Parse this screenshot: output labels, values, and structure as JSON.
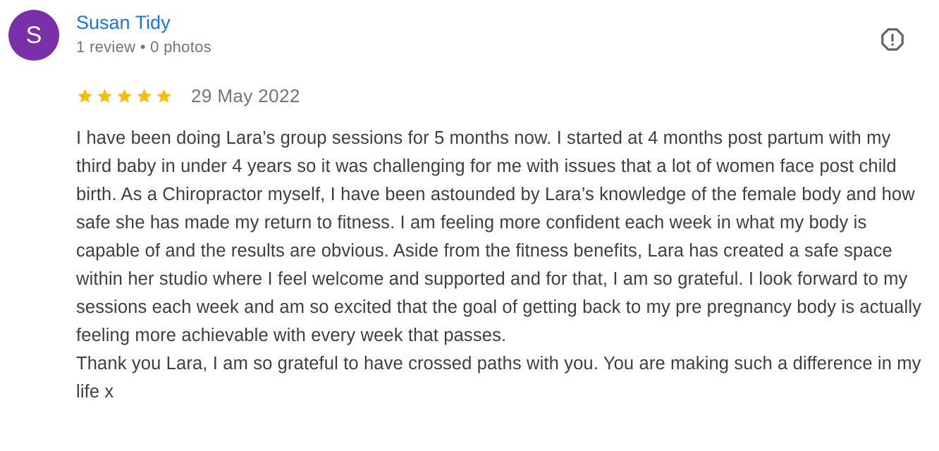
{
  "colors": {
    "avatar_bg": "#7b2fa9",
    "author_name": "#1a73e8",
    "meta_text": "#70757a",
    "body_text": "#3c4043",
    "star": "#fbbc04",
    "icon": "#5f6368"
  },
  "review": {
    "avatar_initial": "S",
    "author_name": "Susan Tidy",
    "author_meta": "1 review • 0 photos",
    "report_icon": "report-flag-icon",
    "rating": 5,
    "rating_max": 5,
    "date": "29 May 2022",
    "text_paragraph_1": "I have been doing Lara’s group sessions for 5 months now. I started at 4 months post partum with my third baby in under 4 years so it was challenging for me with issues that a lot of women face post child birth. As a Chiropractor myself, I have been astounded by Lara’s knowledge of the female body and how safe she has made my return to fitness. I am feeling more confident each week in what my body is capable of and the results are obvious. Aside from the fitness benefits, Lara has created a safe space within her studio where I feel welcome and supported and for that, I am so grateful. I look forward to my sessions each week and am so excited that the goal of getting back to my pre pregnancy body is actually feeling more achievable with every week that passes.",
    "text_paragraph_2": "Thank you Lara, I am so grateful to have crossed paths with you. You are making such a difference in my life x"
  }
}
